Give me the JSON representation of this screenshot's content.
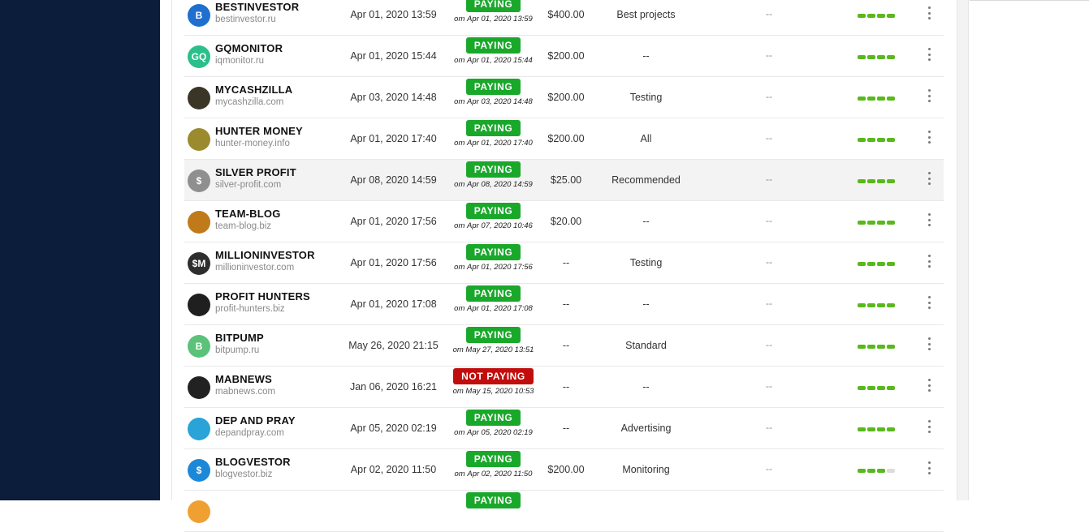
{
  "colors": {
    "sidebar": "#0b1d3a",
    "paying": "#1aa82b",
    "not_paying": "#c20d0d",
    "rating_on": "#59b81c",
    "rating_off": "#dcdcdc"
  },
  "rows": [
    {
      "name": "BESTINVESTOR",
      "domain": "bestinvestor.ru",
      "listed": "Apr 01, 2020 13:59",
      "status": "PAYING",
      "since": "от Apr 01, 2020 13:59",
      "deposit": "$400.00",
      "plan": "Best projects",
      "extra": "--",
      "rating": 4,
      "icon": "bestinvestor-logo-icon",
      "icon_text": "B",
      "icon_color": "#1e6fd0"
    },
    {
      "name": "GQMONITOR",
      "domain": "iqmonitor.ru",
      "listed": "Apr 01, 2020 15:44",
      "status": "PAYING",
      "since": "от Apr 01, 2020 15:44",
      "deposit": "$200.00",
      "plan": "--",
      "extra": "--",
      "rating": 4,
      "icon": "gqmonitor-logo-icon",
      "icon_text": "GQ",
      "icon_color": "#2bbf8a"
    },
    {
      "name": "MYCASHZILLA",
      "domain": "mycashzilla.com",
      "listed": "Apr 03, 2020 14:48",
      "status": "PAYING",
      "since": "от Apr 03, 2020 14:48",
      "deposit": "$200.00",
      "plan": "Testing",
      "extra": "--",
      "rating": 4,
      "icon": "mycashzilla-logo-icon",
      "icon_text": "",
      "icon_color": "#3b3528"
    },
    {
      "name": "HUNTER MONEY",
      "domain": "hunter-money.info",
      "listed": "Apr 01, 2020 17:40",
      "status": "PAYING",
      "since": "от Apr 01, 2020 17:40",
      "deposit": "$200.00",
      "plan": "All",
      "extra": "--",
      "rating": 4,
      "icon": "hunter-money-logo-icon",
      "icon_text": "",
      "icon_color": "#9c8a2e"
    },
    {
      "name": "SILVER PROFIT",
      "domain": "silver-profit.com",
      "listed": "Apr 08, 2020 14:59",
      "status": "PAYING",
      "since": "от Apr 08, 2020 14:59",
      "deposit": "$25.00",
      "plan": "Recommended",
      "extra": "--",
      "rating": 4,
      "icon": "silver-profit-logo-icon",
      "icon_text": "$",
      "icon_color": "#8f8f8f",
      "highlight": true
    },
    {
      "name": "TEAM-BLOG",
      "domain": "team-blog.biz",
      "listed": "Apr 01, 2020 17:56",
      "status": "PAYING",
      "since": "от Apr 07, 2020 10:46",
      "deposit": "$20.00",
      "plan": "--",
      "extra": "--",
      "rating": 4,
      "icon": "team-blog-logo-icon",
      "icon_text": "",
      "icon_color": "#c07a1a"
    },
    {
      "name": "MILLIONINVESTOR",
      "domain": "millioninvestor.com",
      "listed": "Apr 01, 2020 17:56",
      "status": "PAYING",
      "since": "от Apr 01, 2020 17:56",
      "deposit": "--",
      "plan": "Testing",
      "extra": "--",
      "rating": 4,
      "icon": "millioninvestor-logo-icon",
      "icon_text": "$M",
      "icon_color": "#2e2e2e"
    },
    {
      "name": "PROFIT HUNTERS",
      "domain": "profit-hunters.biz",
      "listed": "Apr 01, 2020 17:08",
      "status": "PAYING",
      "since": "от Apr 01, 2020 17:08",
      "deposit": "--",
      "plan": "--",
      "extra": "--",
      "rating": 4,
      "icon": "profit-hunters-logo-icon",
      "icon_text": "",
      "icon_color": "#1f1f1f"
    },
    {
      "name": "BITPUMP",
      "domain": "bitpump.ru",
      "listed": "May 26, 2020 21:15",
      "status": "PAYING",
      "since": "от May 27, 2020 13:51",
      "deposit": "--",
      "plan": "Standard",
      "extra": "--",
      "rating": 4,
      "icon": "bitpump-logo-icon",
      "icon_text": "B",
      "icon_color": "#5bc27a"
    },
    {
      "name": "MABNEWS",
      "domain": "mabnews.com",
      "listed": "Jan 06, 2020 16:21",
      "status": "NOT PAYING",
      "since": "от May 15, 2020 10:53",
      "deposit": "--",
      "plan": "--",
      "extra": "--",
      "rating": 4,
      "icon": "mabnews-logo-icon",
      "icon_text": "",
      "icon_color": "#222222"
    },
    {
      "name": "DEP AND PRAY",
      "domain": "depandpray.com",
      "listed": "Apr 05, 2020 02:19",
      "status": "PAYING",
      "since": "от Apr 05, 2020 02:19",
      "deposit": "--",
      "plan": "Advertising",
      "extra": "--",
      "rating": 4,
      "icon": "dep-and-pray-logo-icon",
      "icon_text": "",
      "icon_color": "#29a3d8"
    },
    {
      "name": "BLOGVESTOR",
      "domain": "blogvestor.biz",
      "listed": "Apr 02, 2020 11:50",
      "status": "PAYING",
      "since": "от Apr 02, 2020 11:50",
      "deposit": "$200.00",
      "plan": "Monitoring",
      "extra": "--",
      "rating": 3,
      "icon": "blogvestor-logo-icon",
      "icon_text": "$",
      "icon_color": "#1e88d8"
    },
    {
      "name": "",
      "domain": "",
      "listed": "",
      "status": "PAYING",
      "since": "",
      "deposit": "",
      "plan": "",
      "extra": "",
      "rating": 0,
      "icon": "next-row-logo-icon",
      "icon_text": "",
      "icon_color": "#f0a030"
    }
  ]
}
